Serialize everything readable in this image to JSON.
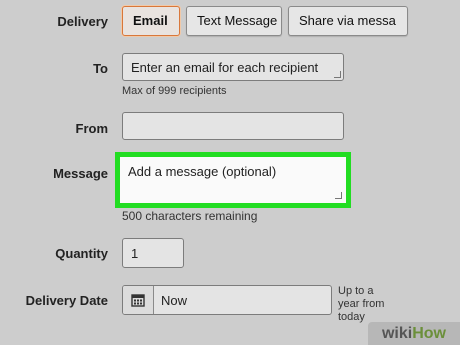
{
  "delivery": {
    "label": "Delivery",
    "options": [
      "Email",
      "Text Message",
      "Share via messa"
    ],
    "selected": "Email"
  },
  "to": {
    "label": "To",
    "placeholder": "Enter an email for each recipient",
    "hint": "Max of 999 recipients"
  },
  "from": {
    "label": "From",
    "value": ""
  },
  "message": {
    "label": "Message",
    "placeholder": "Add a message (optional)",
    "hint": "500 characters remaining",
    "highlight_color": "#22dd22"
  },
  "quantity": {
    "label": "Quantity",
    "value": "1"
  },
  "delivery_date": {
    "label": "Delivery Date",
    "value": "Now",
    "note": "Up to a year from today"
  },
  "watermark": {
    "prefix": "wiki",
    "suffix": "How"
  }
}
